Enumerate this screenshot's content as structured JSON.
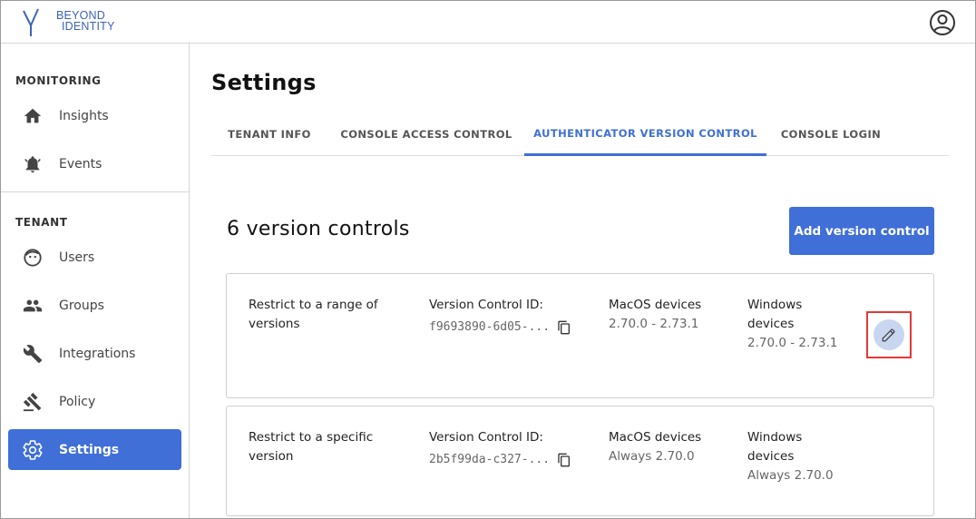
{
  "brand": {
    "line1": "BEYOND",
    "line2": "IDENTITY",
    "accent": "#3f6fd7"
  },
  "header": {
    "avatar_icon": "account-circle-icon"
  },
  "sidebar": {
    "sections": [
      {
        "label": "MONITORING",
        "items": [
          {
            "label": "Insights",
            "icon": "home-icon"
          },
          {
            "label": "Events",
            "icon": "bell-icon"
          }
        ]
      },
      {
        "label": "TENANT",
        "items": [
          {
            "label": "Users",
            "icon": "smiley-icon"
          },
          {
            "label": "Groups",
            "icon": "people-icon"
          },
          {
            "label": "Integrations",
            "icon": "wrench-icon"
          },
          {
            "label": "Policy",
            "icon": "gavel-icon"
          },
          {
            "label": "Settings",
            "icon": "gear-icon",
            "active": true
          }
        ]
      }
    ]
  },
  "main": {
    "title": "Settings",
    "tabs": [
      {
        "label": "TENANT INFO"
      },
      {
        "label": "CONSOLE ACCESS CONTROL"
      },
      {
        "label": "AUTHENTICATOR VERSION CONTROL",
        "active": true
      },
      {
        "label": "CONSOLE LOGIN"
      }
    ],
    "count_heading": "6 version controls",
    "add_button": "Add version control",
    "cards": [
      {
        "description": "Restrict to a range of versions",
        "id_label": "Version Control ID:",
        "id_value": "f9693890-6d05-...",
        "mac_label": "MacOS devices",
        "mac_value": "2.70.0 - 2.73.1",
        "win_label": "Windows devices",
        "win_value": "2.70.0 - 2.73.1",
        "editable": true
      },
      {
        "description": "Restrict to a specific version",
        "id_label": "Version Control ID:",
        "id_value": "2b5f99da-c327-...",
        "mac_label": "MacOS devices",
        "mac_value": "Always 2.70.0",
        "win_label": "Windows devices",
        "win_value": "Always 2.70.0",
        "editable": false
      }
    ]
  }
}
